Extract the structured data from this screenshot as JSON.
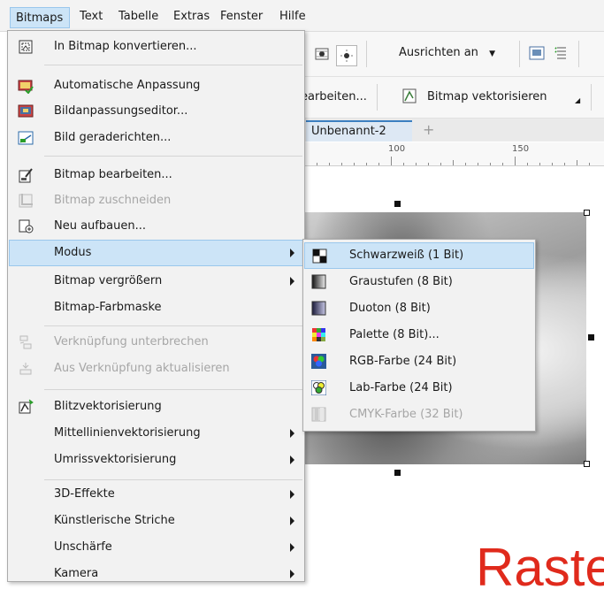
{
  "menubar": {
    "items": [
      {
        "label": "Bitmaps",
        "active": true
      },
      {
        "label": "Text"
      },
      {
        "label": "Tabelle"
      },
      {
        "label": "Extras"
      },
      {
        "label": "Fenster"
      },
      {
        "label": "Hilfe"
      }
    ]
  },
  "toolbar": {
    "align_label": "Ausrichten an",
    "edit_bitmap_label": "earbeiten...",
    "vectorize_label": "Bitmap vektorisieren"
  },
  "document": {
    "tab_title": "Unbenannt-2",
    "add_tab": "+",
    "ruler_marks": [
      "100",
      "150"
    ],
    "canvas_text": "Raste"
  },
  "main_menu": {
    "items": [
      {
        "label": "In Bitmap konvertieren...",
        "icon": "convert-bitmap-icon"
      },
      {
        "label": "Automatische Anpassung",
        "icon": "auto-adjust-icon"
      },
      {
        "label": "Bildanpassungseditor...",
        "icon": "image-adjust-lab-icon"
      },
      {
        "label": "Bild geraderichten...",
        "icon": "straighten-image-icon"
      },
      {
        "label": "Bitmap bearbeiten...",
        "icon": "edit-bitmap-icon"
      },
      {
        "label": "Bitmap zuschneiden",
        "icon": "crop-bitmap-icon",
        "disabled": true
      },
      {
        "label": "Neu aufbauen...",
        "icon": "resample-icon"
      },
      {
        "label": "Modus",
        "submenu": true,
        "highlighted": true
      },
      {
        "label": "Bitmap vergrößern",
        "submenu": true
      },
      {
        "label": "Bitmap-Farbmaske"
      },
      {
        "label": "Verknüpfung unterbrechen",
        "icon": "break-link-icon",
        "disabled": true
      },
      {
        "label": "Aus Verknüpfung aktualisieren",
        "icon": "update-link-icon",
        "disabled": true
      },
      {
        "label": "Blitzvektorisierung",
        "icon": "quick-trace-icon"
      },
      {
        "label": "Mittellinienvektorisierung",
        "submenu": true
      },
      {
        "label": "Umrissvektorisierung",
        "submenu": true
      },
      {
        "label": "3D-Effekte",
        "submenu": true
      },
      {
        "label": "Künstlerische Striche",
        "submenu": true
      },
      {
        "label": "Unschärfe",
        "submenu": true
      },
      {
        "label": "Kamera",
        "submenu": true
      }
    ]
  },
  "mode_submenu": {
    "items": [
      {
        "label": "Schwarzweiß (1 Bit)",
        "icon": "black-white-icon",
        "highlighted": true
      },
      {
        "label": "Graustufen (8 Bit)",
        "icon": "grayscale-icon"
      },
      {
        "label": "Duoton (8 Bit)",
        "icon": "duotone-icon"
      },
      {
        "label": "Palette (8 Bit)...",
        "icon": "palette-icon"
      },
      {
        "label": "RGB-Farbe (24 Bit)",
        "icon": "rgb-icon"
      },
      {
        "label": "Lab-Farbe (24 Bit)",
        "icon": "lab-icon"
      },
      {
        "label": "CMYK-Farbe (32 Bit)",
        "icon": "cmyk-icon",
        "disabled": true
      }
    ]
  },
  "colors": {
    "highlight_bg": "#cce4f7",
    "highlight_border": "#9ac7ec",
    "menu_bg": "#f2f2f2",
    "disabled_text": "#a6a6a6",
    "canvas_text": "#e02a1c",
    "tab_accent": "#3c7fc1"
  }
}
